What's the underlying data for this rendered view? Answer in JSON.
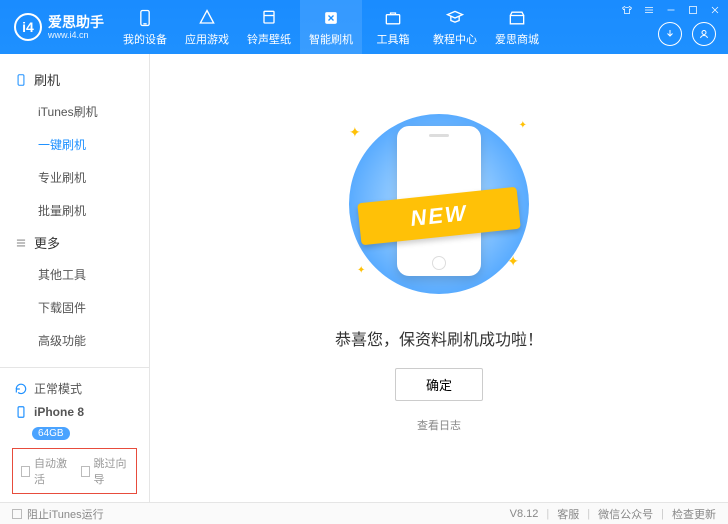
{
  "header": {
    "brand": "爱思助手",
    "domain": "www.i4.cn",
    "logo_text": "i4",
    "nav": [
      {
        "label": "我的设备",
        "icon": "device"
      },
      {
        "label": "应用游戏",
        "icon": "app"
      },
      {
        "label": "铃声壁纸",
        "icon": "ringtone"
      },
      {
        "label": "智能刷机",
        "icon": "flash",
        "active": true
      },
      {
        "label": "工具箱",
        "icon": "toolbox"
      },
      {
        "label": "教程中心",
        "icon": "tutorial"
      },
      {
        "label": "爱思商城",
        "icon": "store"
      }
    ]
  },
  "sidebar": {
    "group1": {
      "title": "刷机",
      "items": [
        "iTunes刷机",
        "一键刷机",
        "专业刷机",
        "批量刷机"
      ],
      "active_index": 1
    },
    "group2": {
      "title": "更多",
      "items": [
        "其他工具",
        "下载固件",
        "高级功能"
      ]
    },
    "mode": "正常模式",
    "device": {
      "name": "iPhone 8",
      "capacity": "64GB"
    },
    "checks": {
      "auto_activate": "自动激活",
      "skip_guide": "跳过向导"
    }
  },
  "main": {
    "ribbon": "NEW",
    "success": "恭喜您，保资料刷机成功啦！",
    "ok": "确定",
    "view_log": "查看日志"
  },
  "statusbar": {
    "block_itunes": "阻止iTunes运行",
    "version": "V8.12",
    "links": [
      "客服",
      "微信公众号",
      "检查更新"
    ]
  }
}
